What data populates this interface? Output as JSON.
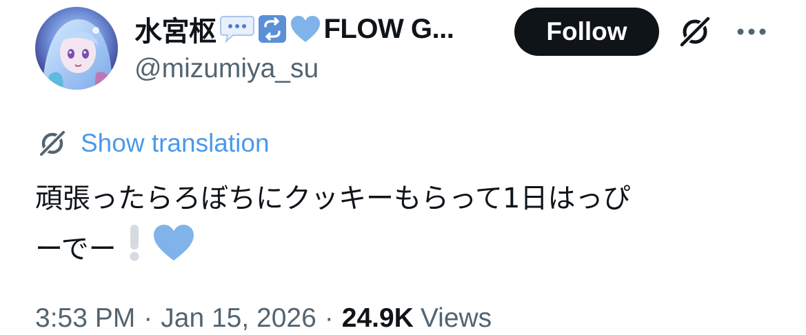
{
  "user": {
    "display_name": "水宮枢",
    "name_tail": "FLOW G...",
    "handle": "@mizumiya_su",
    "avatar_icon": "avatar-anime-girl"
  },
  "header": {
    "follow_label": "Follow",
    "grok_icon": "grok-icon",
    "more_icon": "more-icon"
  },
  "translation": {
    "label": "Show translation",
    "icon": "grok-icon"
  },
  "tweet": {
    "line1": "頑張ったらろぼちにクッキーもらって1日はっぴ",
    "line2": "ーでー",
    "emojis": [
      "white-exclamation-emoji",
      "blue-heart-emoji"
    ]
  },
  "meta": {
    "time": "3:53 PM",
    "separator": "·",
    "date": "Jan 15, 2026",
    "views_count": "24.9K",
    "views_label": "Views"
  },
  "colors": {
    "text": "#0f1419",
    "secondary": "#536471",
    "link": "#4a99e9",
    "follow_bg": "#0f1419",
    "heart": "#7fb3ea",
    "repost_badge": "#5b8fd8"
  }
}
